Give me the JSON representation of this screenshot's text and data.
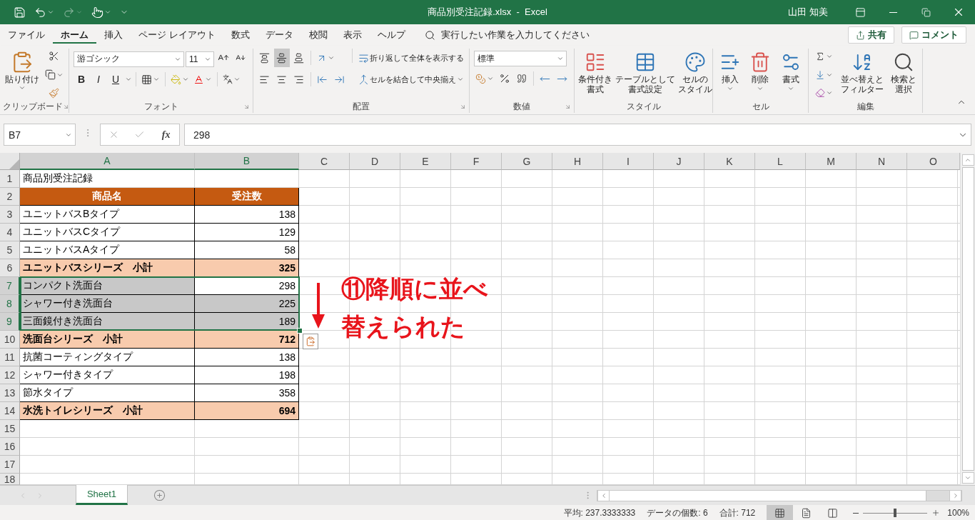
{
  "title_bar": {
    "title": "商品別受注記録.xlsx  -  Excel",
    "user": "山田 知美"
  },
  "menu": {
    "tabs": [
      {
        "label": "ファイル",
        "selected": false
      },
      {
        "label": "ホーム",
        "selected": true
      },
      {
        "label": "挿入",
        "selected": false
      },
      {
        "label": "ページ レイアウト",
        "selected": false
      },
      {
        "label": "数式",
        "selected": false
      },
      {
        "label": "データ",
        "selected": false
      },
      {
        "label": "校閲",
        "selected": false
      },
      {
        "label": "表示",
        "selected": false
      },
      {
        "label": "ヘルプ",
        "selected": false
      }
    ],
    "tell_me": "実行したい作業を入力してください",
    "share": "共有",
    "comment": "コメント"
  },
  "ribbon": {
    "clipboard": {
      "paste": "貼り付け",
      "label": "クリップボード"
    },
    "font": {
      "name": "游ゴシック",
      "size": "11",
      "styles": [
        "B",
        "I",
        "U"
      ],
      "label": "フォント"
    },
    "alignment": {
      "vertical": [
        {
          "kind": "top",
          "selected": false
        },
        {
          "kind": "middle",
          "selected": true
        },
        {
          "kind": "bottom",
          "selected": false
        }
      ],
      "horizontal": [
        {
          "kind": "left",
          "selected": false
        },
        {
          "kind": "center",
          "selected": false
        },
        {
          "kind": "right",
          "selected": false
        }
      ],
      "wrap": "折り返して全体を表示する",
      "merge": "セルを結合して中央揃え",
      "label": "配置"
    },
    "number": {
      "format": "標準",
      "label": "数値"
    },
    "styles": {
      "buttons": [
        {
          "kind": "conditional",
          "lines": [
            "条件付き",
            "書式"
          ]
        },
        {
          "kind": "table",
          "lines": [
            "テーブルとして",
            "書式設定"
          ]
        },
        {
          "kind": "cell_styles",
          "lines": [
            "セルの",
            "スタイル"
          ]
        }
      ],
      "label": "スタイル"
    },
    "cells": {
      "buttons": [
        {
          "kind": "insert",
          "lines": [
            "挿入"
          ]
        },
        {
          "kind": "delete",
          "lines": [
            "削除"
          ]
        },
        {
          "kind": "format",
          "lines": [
            "書式"
          ]
        }
      ],
      "label": "セル"
    },
    "editing": {
      "buttons": [
        {
          "kind": "sort",
          "lines": [
            "並べ替えと",
            "フィルター"
          ]
        },
        {
          "kind": "find",
          "lines": [
            "検索と",
            "選択"
          ]
        }
      ],
      "label": "編集"
    }
  },
  "formula_bar": {
    "name_box": "B7",
    "fx": "fx",
    "value": "298"
  },
  "sheet": {
    "columns": [
      {
        "label": "A",
        "selected": true
      },
      {
        "label": "B",
        "selected": true
      },
      {
        "label": "C",
        "selected": false
      },
      {
        "label": "D",
        "selected": false
      },
      {
        "label": "E",
        "selected": false
      },
      {
        "label": "F",
        "selected": false
      },
      {
        "label": "G",
        "selected": false
      },
      {
        "label": "H",
        "selected": false
      },
      {
        "label": "I",
        "selected": false
      },
      {
        "label": "J",
        "selected": false
      },
      {
        "label": "K",
        "selected": false
      },
      {
        "label": "L",
        "selected": false
      },
      {
        "label": "M",
        "selected": false
      },
      {
        "label": "N",
        "selected": false
      },
      {
        "label": "O",
        "selected": false
      }
    ],
    "rows": [
      {
        "number": "1",
        "kind": "title",
        "a": "商品別受注記録",
        "selected": false
      },
      {
        "number": "2",
        "kind": "header",
        "a": "商品名",
        "b": "受注数",
        "selected": false
      },
      {
        "number": "3",
        "kind": "item",
        "a": "ユニットバスBタイプ",
        "b": "138",
        "selected": false
      },
      {
        "number": "4",
        "kind": "item",
        "a": "ユニットバスCタイプ",
        "b": "129",
        "selected": false
      },
      {
        "number": "5",
        "kind": "item",
        "a": "ユニットバスAタイプ",
        "b": "58",
        "selected": false
      },
      {
        "number": "6",
        "kind": "subtotal",
        "a": "ユニットバスシリーズ　小計",
        "b": "325",
        "selected": false
      },
      {
        "number": "7",
        "kind": "item",
        "a": "コンパクト洗面台",
        "b": "298",
        "selected": true,
        "active": true
      },
      {
        "number": "8",
        "kind": "item",
        "a": "シャワー付き洗面台",
        "b": "225",
        "selected": true,
        "active": false
      },
      {
        "number": "9",
        "kind": "item",
        "a": "三面鏡付き洗面台",
        "b": "189",
        "selected": true,
        "active": false
      },
      {
        "number": "10",
        "kind": "subtotal",
        "a": "洗面台シリーズ　小計",
        "b": "712",
        "selected": false
      },
      {
        "number": "11",
        "kind": "item",
        "a": "抗菌コーティングタイプ",
        "b": "138",
        "selected": false
      },
      {
        "number": "12",
        "kind": "item",
        "a": "シャワー付きタイプ",
        "b": "198",
        "selected": false
      },
      {
        "number": "13",
        "kind": "item",
        "a": "節水タイプ",
        "b": "358",
        "selected": false
      },
      {
        "number": "14",
        "kind": "subtotal",
        "a": "水洗トイレシリーズ　小計",
        "b": "694",
        "selected": false
      },
      {
        "number": "15",
        "kind": "empty",
        "selected": false
      },
      {
        "number": "16",
        "kind": "empty",
        "selected": false
      },
      {
        "number": "17",
        "kind": "empty",
        "selected": false
      },
      {
        "number": "18",
        "kind": "empty",
        "selected": false
      }
    ]
  },
  "annotation": {
    "lines": [
      "⑪降順に並べ",
      "替えられた"
    ]
  },
  "sheet_tabs": [
    {
      "label": "Sheet1",
      "selected": true
    }
  ],
  "status_bar": {
    "average": "平均: 237.3333333",
    "count": "データの個数: 6",
    "sum": "合計: 712",
    "views": [
      {
        "kind": "normal",
        "selected": true
      },
      {
        "kind": "page_layout",
        "selected": false
      },
      {
        "kind": "page_break",
        "selected": false
      }
    ],
    "zoom": {
      "level": 0.5,
      "reading": "100%"
    }
  }
}
